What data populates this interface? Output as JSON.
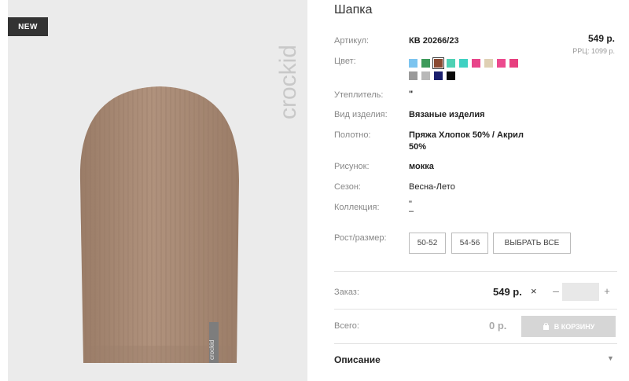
{
  "badge": {
    "label": "NEW"
  },
  "brand": {
    "logo_text": "crockid",
    "label_text": "crockid"
  },
  "product": {
    "title": "Шапка",
    "price": "549 р.",
    "rrp": "РРЦ: 1099 р."
  },
  "details": {
    "article": {
      "label": "Артикул:",
      "value": "КВ 20266/23"
    },
    "color": {
      "label": "Цвет:"
    },
    "insulation": {
      "label": "Утеплитель:",
      "value": "\""
    },
    "type": {
      "label": "Вид изделия:",
      "value": "Вязаные изделия"
    },
    "fabric": {
      "label": "Полотно:",
      "value_line1": "Пряжа Хлопок 50% / Акрил",
      "value_line2": "50%"
    },
    "pattern": {
      "label": "Рисунок:",
      "value": "мокка"
    },
    "season": {
      "label": "Сезон:",
      "value": "Весна-Лето"
    },
    "collection": {
      "label": "Коллекция:",
      "value_line1": "\"",
      "value_line2": "–"
    }
  },
  "colors": [
    {
      "name": "light-blue",
      "hex": "#7cc4ef",
      "selected": false
    },
    {
      "name": "green",
      "hex": "#3d9a5a",
      "selected": false
    },
    {
      "name": "mocha",
      "hex": "#8a4a32",
      "selected": true
    },
    {
      "name": "mint",
      "hex": "#4fd1b4",
      "selected": false
    },
    {
      "name": "turquoise",
      "hex": "#3fd1c2",
      "selected": false
    },
    {
      "name": "pink",
      "hex": "#e8458a",
      "selected": false
    },
    {
      "name": "beige",
      "hex": "#dfd0b4",
      "selected": false
    },
    {
      "name": "pink-2",
      "hex": "#ec4a8e",
      "selected": false
    },
    {
      "name": "pink-3",
      "hex": "#e7407f",
      "selected": false
    },
    {
      "name": "grey",
      "hex": "#9a9a9a",
      "selected": false
    },
    {
      "name": "light-grey",
      "hex": "#b8b8b8",
      "selected": false
    },
    {
      "name": "navy",
      "hex": "#1a1f6e",
      "selected": false
    },
    {
      "name": "black",
      "hex": "#0a0a0a",
      "selected": false
    }
  ],
  "sizes": {
    "label": "Рост/размер:",
    "options": [
      "50-52",
      "54-56"
    ],
    "select_all": "ВЫБРАТЬ ВСЕ"
  },
  "order": {
    "label": "Заказ:",
    "price": "549 р.",
    "times": "×",
    "minus": "–",
    "plus": "+",
    "quantity": ""
  },
  "total": {
    "label": "Всего:",
    "value": "0 р.",
    "cart_button": "В КОРЗИНУ"
  },
  "description": {
    "label": "Описание"
  },
  "icons": {
    "cart": "cart-icon",
    "chevron": "chevron-down-icon",
    "close": "times-icon"
  },
  "theme": {
    "product_color": "#a98b76",
    "badge_bg": "#333333",
    "photo_bg": "#ebebeb"
  }
}
